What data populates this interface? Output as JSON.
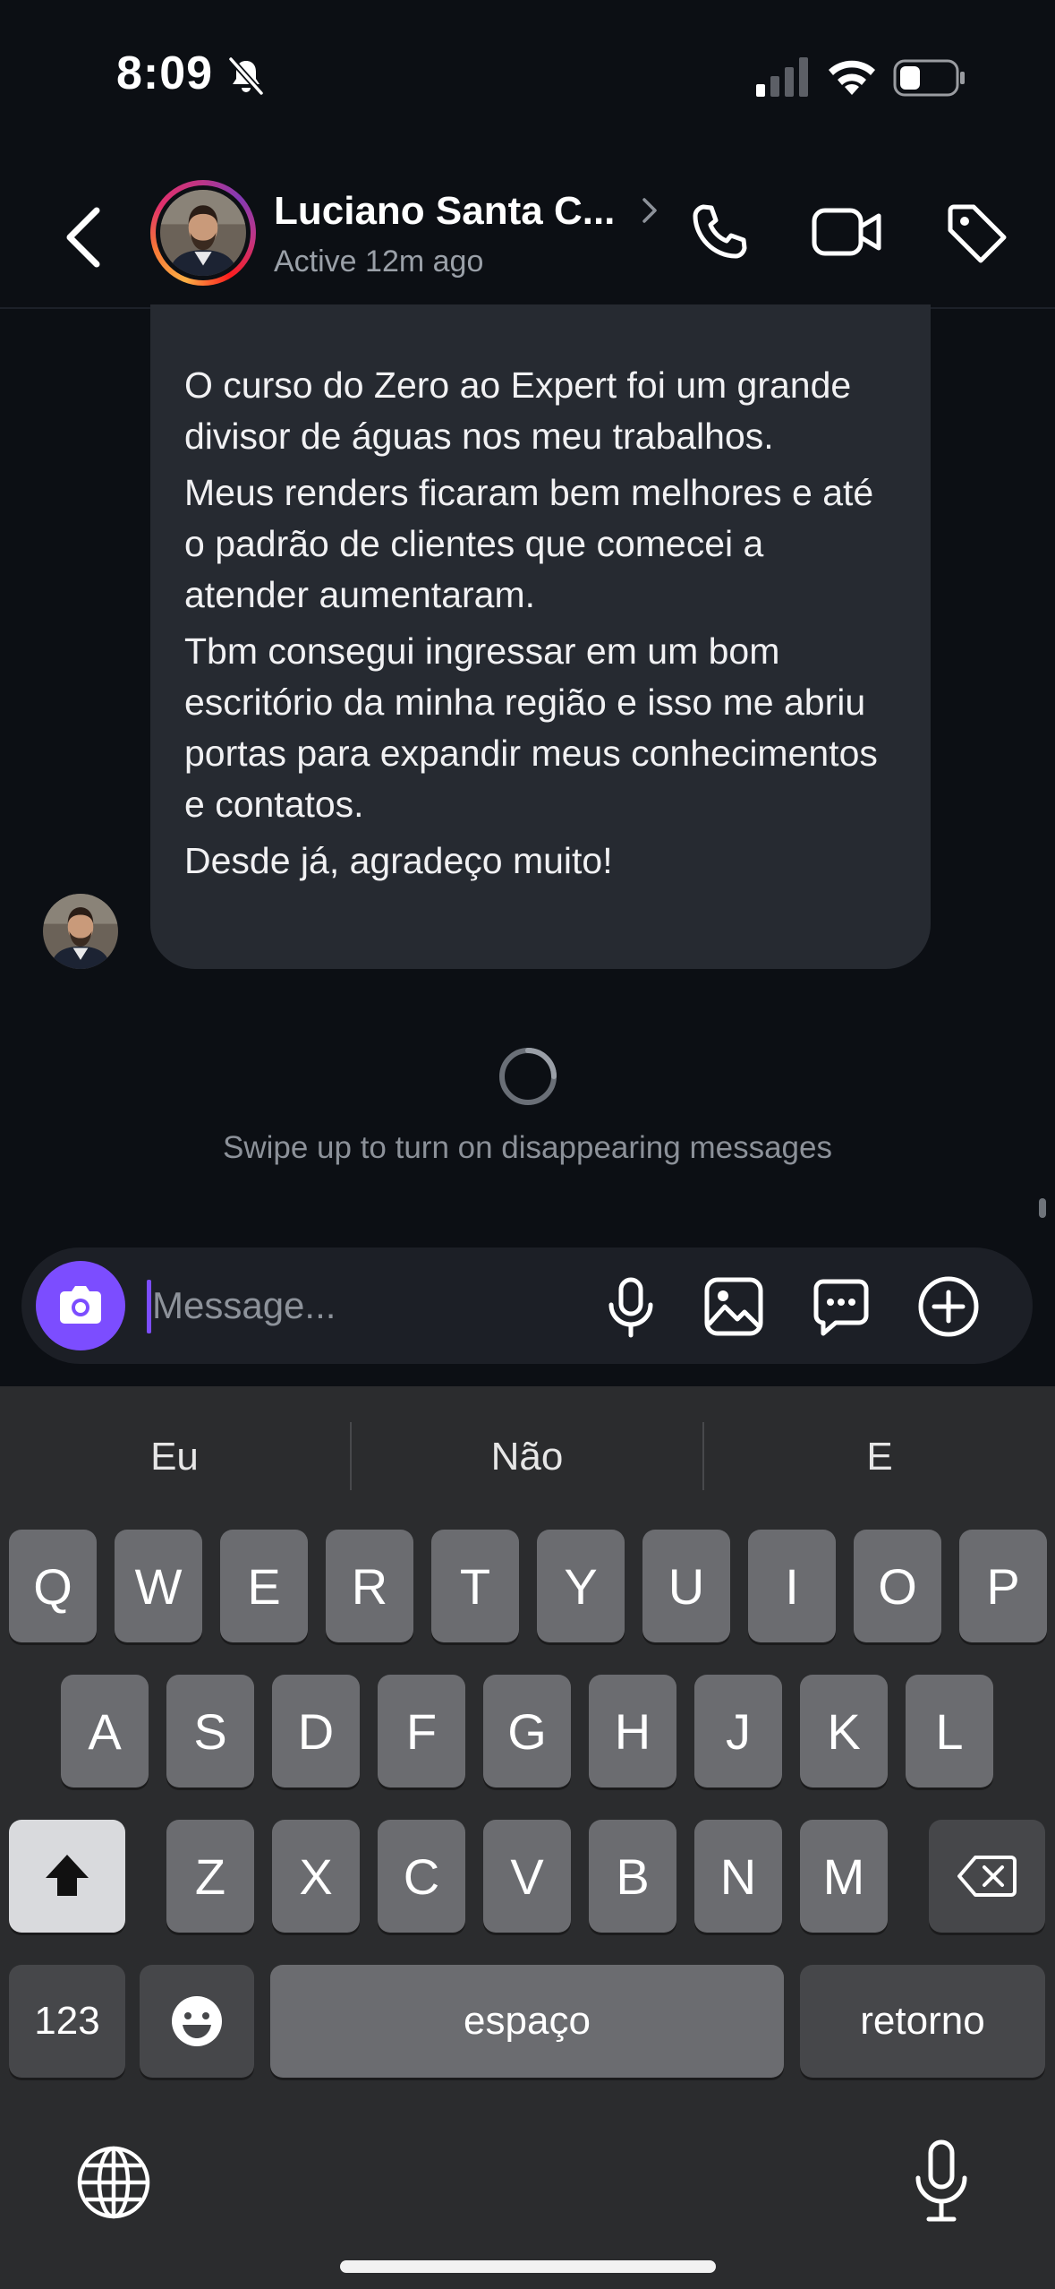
{
  "status_bar": {
    "time": "8:09"
  },
  "header": {
    "contact_name": "Luciano Santa C...",
    "contact_status": "Active 12m ago"
  },
  "message": {
    "paragraphs": [
      "O curso do Zero ao Expert foi um grande divisor de águas nos meu trabalhos.",
      "Meus renders ficaram bem melhores e até o padrão de clientes que comecei a atender aumentaram.",
      "Tbm consegui ingressar em um bom escritório da minha região e isso me abriu portas para expandir meus conhecimentos e contatos.",
      "Desde já, agradeço muito!"
    ]
  },
  "disappearing_hint": "Swipe up to turn on disappearing messages",
  "composer": {
    "placeholder": "Message...",
    "value": ""
  },
  "keyboard": {
    "suggestions": [
      "Eu",
      "Não",
      "E"
    ],
    "row1": [
      "Q",
      "W",
      "E",
      "R",
      "T",
      "Y",
      "U",
      "I",
      "O",
      "P"
    ],
    "row2": [
      "A",
      "S",
      "D",
      "F",
      "G",
      "H",
      "J",
      "K",
      "L"
    ],
    "row3": [
      "Z",
      "X",
      "C",
      "V",
      "B",
      "N",
      "M"
    ],
    "numbers_label": "123",
    "space_label": "espaço",
    "return_label": "retorno"
  },
  "colors": {
    "background": "#0c0f14",
    "bubble": "#262a31",
    "accent": "#7c4dff",
    "keyboard": "#2b2c2e"
  },
  "icons": {
    "status": [
      "bell-slash-icon",
      "cellular-signal-icon",
      "wifi-icon",
      "battery-icon"
    ],
    "header": [
      "back-arrow-icon",
      "chevron-right-icon",
      "phone-icon",
      "video-camera-icon",
      "tag-icon"
    ],
    "composer": [
      "camera-icon",
      "microphone-icon",
      "gallery-icon",
      "sticker-chat-icon",
      "plus-circle-icon"
    ],
    "keyboard": [
      "shift-icon",
      "delete-icon",
      "emoji-icon",
      "globe-icon",
      "dictation-mic-icon"
    ]
  }
}
